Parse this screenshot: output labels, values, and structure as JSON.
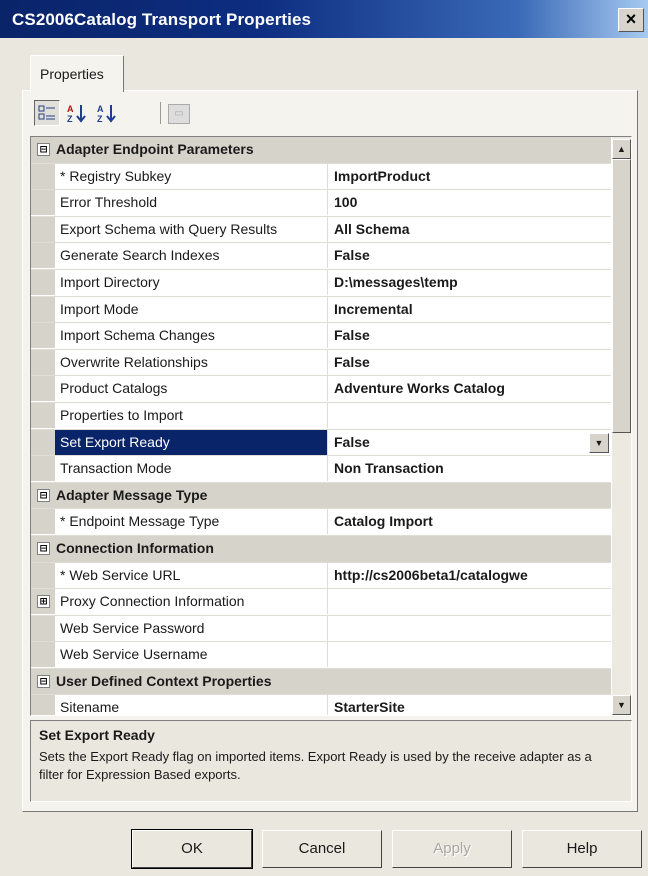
{
  "window": {
    "title": "CS2006Catalog Transport Properties",
    "close_glyph": "×"
  },
  "tabs": [
    {
      "label": "Properties"
    }
  ],
  "toolbar": {
    "categorized_icon": "categorized-icon",
    "sort_az_icon": "sort-az-icon",
    "sort_za_icon": "sort-za-icon",
    "pages_icon": "property-pages-icon"
  },
  "grid": {
    "categories": [
      {
        "label": "Adapter Endpoint Parameters",
        "expander": "⊟",
        "properties": [
          {
            "name": "* Registry Subkey",
            "value": "ImportProduct"
          },
          {
            "name": "Error Threshold",
            "value": "100"
          },
          {
            "name": "Export Schema with Query Results",
            "value": "All Schema"
          },
          {
            "name": "Generate Search Indexes",
            "value": "False"
          },
          {
            "name": "Import Directory",
            "value": "D:\\messages\\temp"
          },
          {
            "name": "Import Mode",
            "value": "Incremental"
          },
          {
            "name": "Import Schema Changes",
            "value": "False"
          },
          {
            "name": "Overwrite Relationships",
            "value": "False"
          },
          {
            "name": "Product Catalogs",
            "value": "Adventure Works Catalog"
          },
          {
            "name": "Properties to Import",
            "value": ""
          },
          {
            "name": "Set Export Ready",
            "value": "False",
            "selected": true
          },
          {
            "name": "Transaction Mode",
            "value": "Non Transaction"
          }
        ]
      },
      {
        "label": "Adapter Message Type",
        "expander": "⊟",
        "properties": [
          {
            "name": "* Endpoint Message Type",
            "value": "Catalog Import"
          }
        ]
      },
      {
        "label": "Connection Information",
        "expander": "⊟",
        "properties": [
          {
            "name": "* Web Service URL",
            "value": "http://cs2006beta1/catalogwe"
          },
          {
            "name": "Proxy Connection Information",
            "value": "",
            "expander": "⊞"
          },
          {
            "name": "Web Service Password",
            "value": ""
          },
          {
            "name": "Web Service Username",
            "value": ""
          }
        ]
      },
      {
        "label": "User Defined Context Properties",
        "expander": "⊟",
        "properties": [
          {
            "name": "Sitename",
            "value": "StarterSite"
          }
        ]
      }
    ]
  },
  "description": {
    "title": "Set Export Ready",
    "text": "Sets the Export Ready flag on imported items.  Export Ready is used by the receive adapter as a filter for Expression Based exports."
  },
  "buttons": {
    "ok": "OK",
    "cancel": "Cancel",
    "apply": "Apply",
    "help": "Help"
  },
  "colors": {
    "titlebar": "#0a246a",
    "selection": "#0a246a",
    "dialog": "#eae7de"
  }
}
